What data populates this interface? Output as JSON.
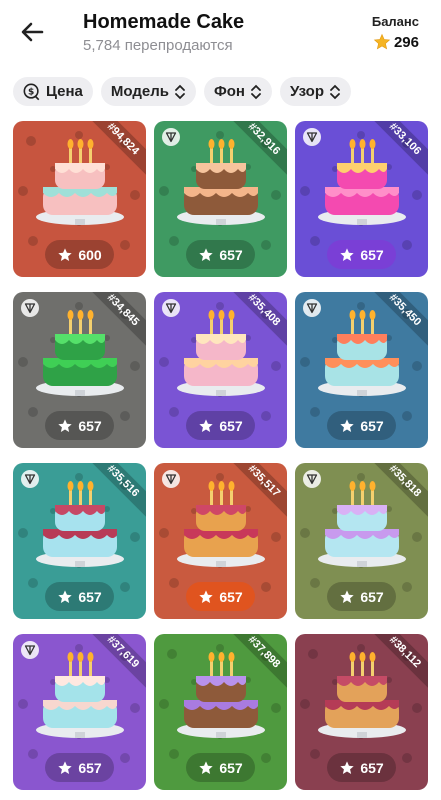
{
  "header": {
    "title": "Homemade Cake",
    "subtitle": "5,784 перепродаются",
    "balance_label": "Баланс",
    "balance_value": "296"
  },
  "filters": [
    {
      "label": "Цена"
    },
    {
      "label": "Модель"
    },
    {
      "label": "Фон"
    },
    {
      "label": "Узор"
    }
  ],
  "items": [
    {
      "number": "#94,824",
      "price": "600",
      "bg": "#c7553f",
      "ton": false,
      "price_style": "dark",
      "frosting": "#9fe0d8",
      "cake": "#f7c0c0",
      "top": "#ffe0d6"
    },
    {
      "number": "#32,916",
      "price": "657",
      "bg": "#3f9a62",
      "ton": true,
      "price_style": "dark",
      "frosting": "#f4b58a",
      "cake": "#8e5a3a",
      "top": "#f6c49d"
    },
    {
      "number": "#33,106",
      "price": "657",
      "bg": "#6a4fd6",
      "ton": true,
      "price_style": "purple",
      "frosting": "#ff8fc9",
      "cake": "#f44ab0",
      "top": "#ffd06e"
    },
    {
      "number": "#34,845",
      "price": "657",
      "bg": "#6f6f6c",
      "ton": true,
      "price_style": "dark",
      "frosting": "#3fcf55",
      "cake": "#2fa247",
      "top": "#55e06a"
    },
    {
      "number": "#35,408",
      "price": "657",
      "bg": "#7a54d4",
      "ton": true,
      "price_style": "dark",
      "frosting": "#ffd3a0",
      "cake": "#f5b7c9",
      "top": "#ffe6be"
    },
    {
      "number": "#35,450",
      "price": "657",
      "bg": "#3f7aa0",
      "ton": true,
      "price_style": "dark",
      "frosting": "#ff8f5a",
      "cake": "#a8e3e6",
      "top": "#ff7f5c"
    },
    {
      "number": "#35,516",
      "price": "657",
      "bg": "#3a9d96",
      "ton": true,
      "price_style": "dark",
      "frosting": "#b83b57",
      "cake": "#a7e2ee",
      "top": "#c64865"
    },
    {
      "number": "#35,517",
      "price": "657",
      "bg": "#c95a3f",
      "ton": true,
      "price_style": "orange",
      "frosting": "#c8385a",
      "cake": "#e8a24e",
      "top": "#cf4766"
    },
    {
      "number": "#35,818",
      "price": "657",
      "bg": "#7f8f52",
      "ton": true,
      "price_style": "dark",
      "frosting": "#c89aee",
      "cake": "#b4e6f1",
      "top": "#d9b1f5"
    },
    {
      "number": "#37,619",
      "price": "657",
      "bg": "#8a56cf",
      "ton": true,
      "price_style": "dark",
      "frosting": "#f7d7cf",
      "cake": "#a4e3ea",
      "top": "#ffe8e0"
    },
    {
      "number": "#37,898",
      "price": "657",
      "bg": "#4f9a3f",
      "ton": false,
      "price_style": "dark",
      "frosting": "#a97be0",
      "cake": "#8e5a3a",
      "top": "#b892ec"
    },
    {
      "number": "#38,112",
      "price": "657",
      "bg": "#8a4050",
      "ton": false,
      "price_style": "dark",
      "frosting": "#b53b56",
      "cake": "#e3a25a",
      "top": "#c54b66"
    }
  ]
}
